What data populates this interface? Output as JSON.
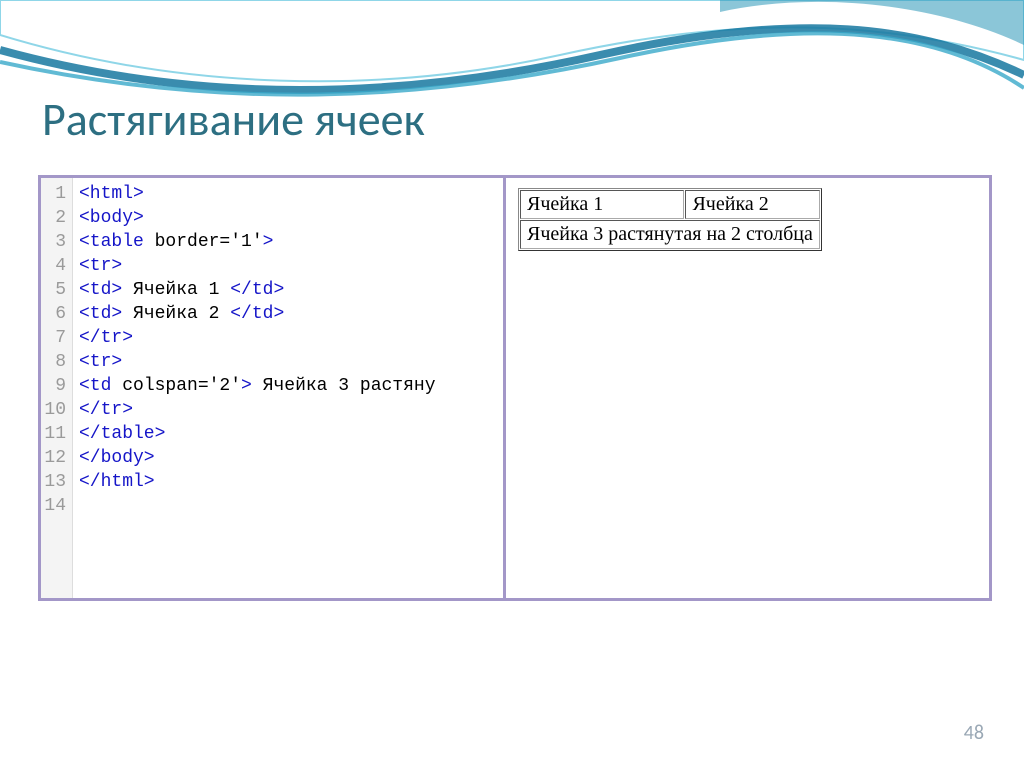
{
  "title": "Растягивание ячеек",
  "page_number": "48",
  "code": {
    "lines": [
      {
        "n": "1",
        "html": "<span class='tag'>&lt;html&gt;</span>"
      },
      {
        "n": "2",
        "html": "<span class='tag'>&lt;body&gt;</span>"
      },
      {
        "n": "3",
        "html": "<span class='tag'>&lt;table</span> <span class='txt'>border='1'</span><span class='tag'>&gt;</span>"
      },
      {
        "n": "4",
        "html": "<span class='tag'>&lt;tr&gt;</span>"
      },
      {
        "n": "5",
        "html": "<span class='tag'>&lt;td&gt;</span> <span class='txt'>Ячейка 1 </span><span class='tag'>&lt;/td&gt;</span>"
      },
      {
        "n": "6",
        "html": "<span class='tag'>&lt;td&gt;</span> <span class='txt'>Ячейка 2 </span><span class='tag'>&lt;/td&gt;</span>"
      },
      {
        "n": "7",
        "html": "<span class='tag'>&lt;/tr&gt;</span>"
      },
      {
        "n": "8",
        "html": "<span class='tag'>&lt;tr&gt;</span>"
      },
      {
        "n": "9",
        "html": "<span class='tag'>&lt;td</span> <span class='txt'>colspan='2'</span><span class='tag'>&gt;</span> <span class='txt'>Ячейка 3 растяну</span>"
      },
      {
        "n": "10",
        "html": "<span class='tag'>&lt;/tr&gt;</span>"
      },
      {
        "n": "11",
        "html": "<span class='tag'>&lt;/table&gt;</span>"
      },
      {
        "n": "12",
        "html": "<span class='tag'>&lt;/body&gt;</span>"
      },
      {
        "n": "13",
        "html": "<span class='tag'>&lt;/html&gt;</span>"
      },
      {
        "n": "14",
        "html": ""
      }
    ]
  },
  "output_table": {
    "row1": {
      "c1": "Ячейка 1",
      "c2": "Ячейка 2"
    },
    "row2": {
      "span": "Ячейка 3 растянутая на 2 столбца"
    }
  }
}
